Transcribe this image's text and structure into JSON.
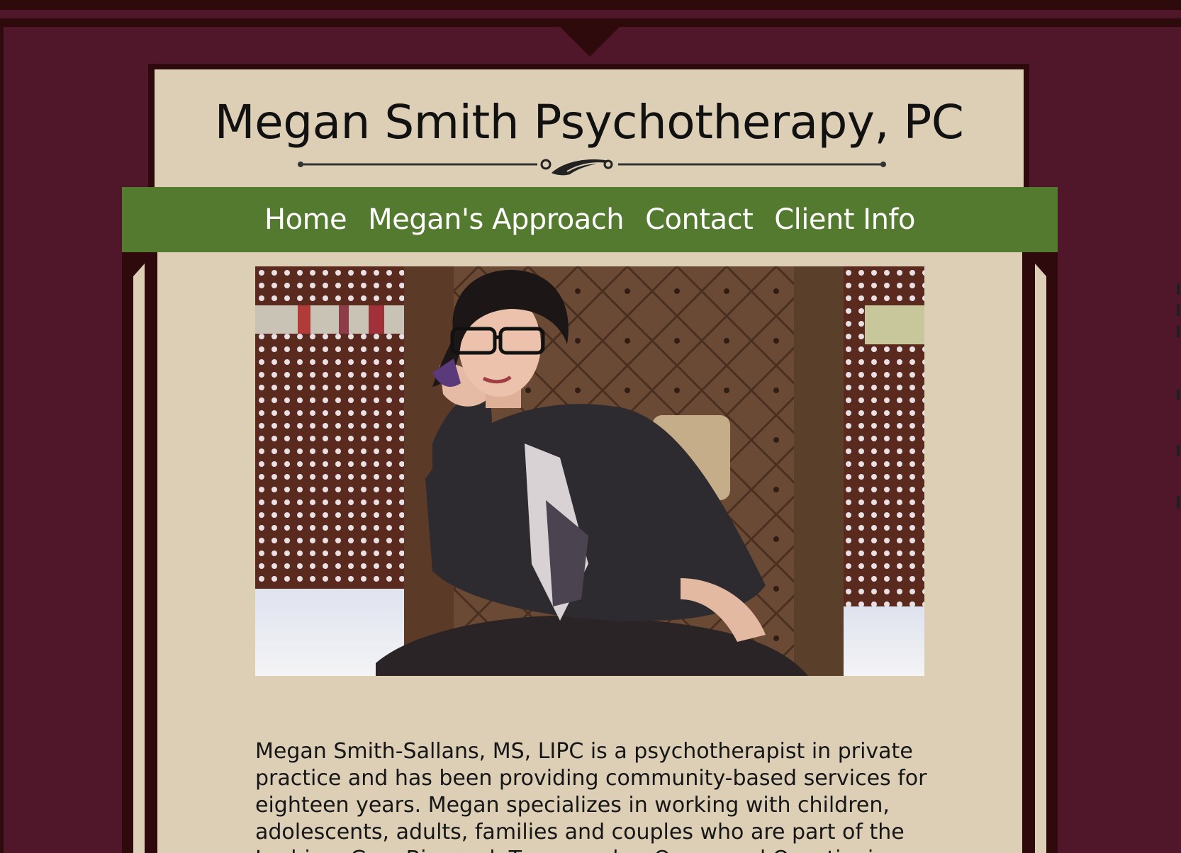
{
  "site": {
    "title": "Megan Smith Psychotherapy, PC"
  },
  "nav": {
    "items": [
      {
        "label": "Home"
      },
      {
        "label": "Megan's Approach"
      },
      {
        "label": "Contact"
      },
      {
        "label": "Client Info"
      }
    ]
  },
  "hero": {
    "photo_alt": "Megan Smith seated in a tufted armchair"
  },
  "bio": {
    "text": "Megan Smith-Sallans, MS, LIPC is a psychotherapist in private practice and has been providing community-based services for eighteen years. Megan specializes in working with children, adolescents, adults, families and couples who are part of the Lesbian, Gay, Bisexual, Transgender, Queer and Questioning"
  },
  "colors": {
    "background": "#4f1729",
    "frame": "#2e0a0d",
    "card": "#dccfb6",
    "nav": "#547a2f",
    "nav_text": "#ffffff"
  },
  "icons": {
    "ornament": "flourish-divider-icon"
  }
}
